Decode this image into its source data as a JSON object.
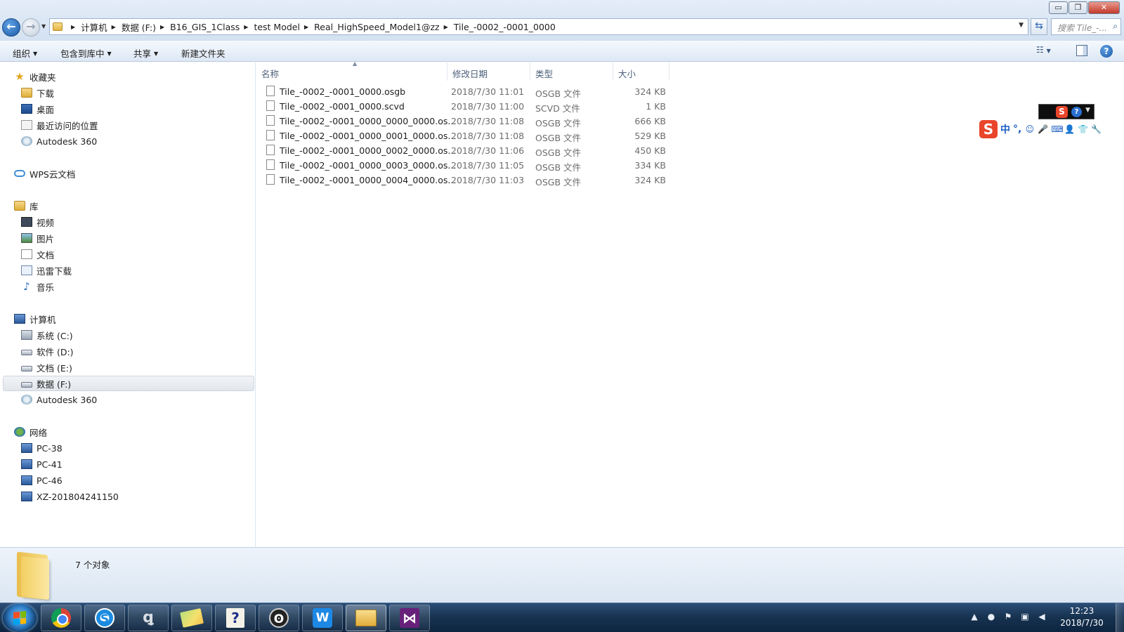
{
  "window": {
    "min_glyph": "▭",
    "max_glyph": "❐",
    "close_glyph": "✕"
  },
  "address": {
    "crumbs": [
      "计算机",
      "数据 (F:)",
      "B16_GIS_1Class",
      "test Model",
      "Real_HighSpeed_Model1@zz",
      "Tile_-0002_-0001_0000"
    ]
  },
  "search": {
    "placeholder": "搜索 Tile_-..."
  },
  "toolbar": {
    "organize": "组织",
    "include_library": "包含到库中",
    "share": "共享",
    "new_folder": "新建文件夹"
  },
  "sidebar": {
    "favorites": {
      "label": "收藏夹",
      "items": [
        "下载",
        "桌面",
        "最近访问的位置",
        "Autodesk 360"
      ]
    },
    "wps": "WPS云文档",
    "libraries": {
      "label": "库",
      "items": [
        "视频",
        "图片",
        "文档",
        "迅雷下载",
        "音乐"
      ]
    },
    "computer": {
      "label": "计算机",
      "items": [
        "系统 (C:)",
        "软件 (D:)",
        "文档 (E:)",
        "数据 (F:)",
        "Autodesk 360"
      ]
    },
    "network": {
      "label": "网络",
      "items": [
        "PC-38",
        "PC-41",
        "PC-46",
        "XZ-201804241150"
      ]
    }
  },
  "columns": {
    "name": "名称",
    "date": "修改日期",
    "type": "类型",
    "size": "大小"
  },
  "files": [
    {
      "name": "Tile_-0002_-0001_0000.osgb",
      "date": "2018/7/30 11:01",
      "type": "OSGB 文件",
      "size": "324 KB"
    },
    {
      "name": "Tile_-0002_-0001_0000.scvd",
      "date": "2018/7/30 11:00",
      "type": "SCVD 文件",
      "size": "1 KB"
    },
    {
      "name": "Tile_-0002_-0001_0000_0000_0000.os...",
      "date": "2018/7/30 11:08",
      "type": "OSGB 文件",
      "size": "666 KB"
    },
    {
      "name": "Tile_-0002_-0001_0000_0001_0000.os...",
      "date": "2018/7/30 11:08",
      "type": "OSGB 文件",
      "size": "529 KB"
    },
    {
      "name": "Tile_-0002_-0001_0000_0002_0000.os...",
      "date": "2018/7/30 11:06",
      "type": "OSGB 文件",
      "size": "450 KB"
    },
    {
      "name": "Tile_-0002_-0001_0000_0003_0000.os...",
      "date": "2018/7/30 11:05",
      "type": "OSGB 文件",
      "size": "334 KB"
    },
    {
      "name": "Tile_-0002_-0001_0000_0004_0000.os...",
      "date": "2018/7/30 11:03",
      "type": "OSGB 文件",
      "size": "324 KB"
    }
  ],
  "ime": {
    "mode": "中",
    "punct": "°,"
  },
  "details": {
    "count": "7 个对象"
  },
  "taskbar": {
    "apps": [
      "chrome",
      "sogou-browser",
      "sketch-tool",
      "sticky-notes",
      "help",
      "terminal",
      "wps",
      "explorer",
      "visual-studio"
    ],
    "time": "12:23",
    "date": "2018/7/30"
  }
}
